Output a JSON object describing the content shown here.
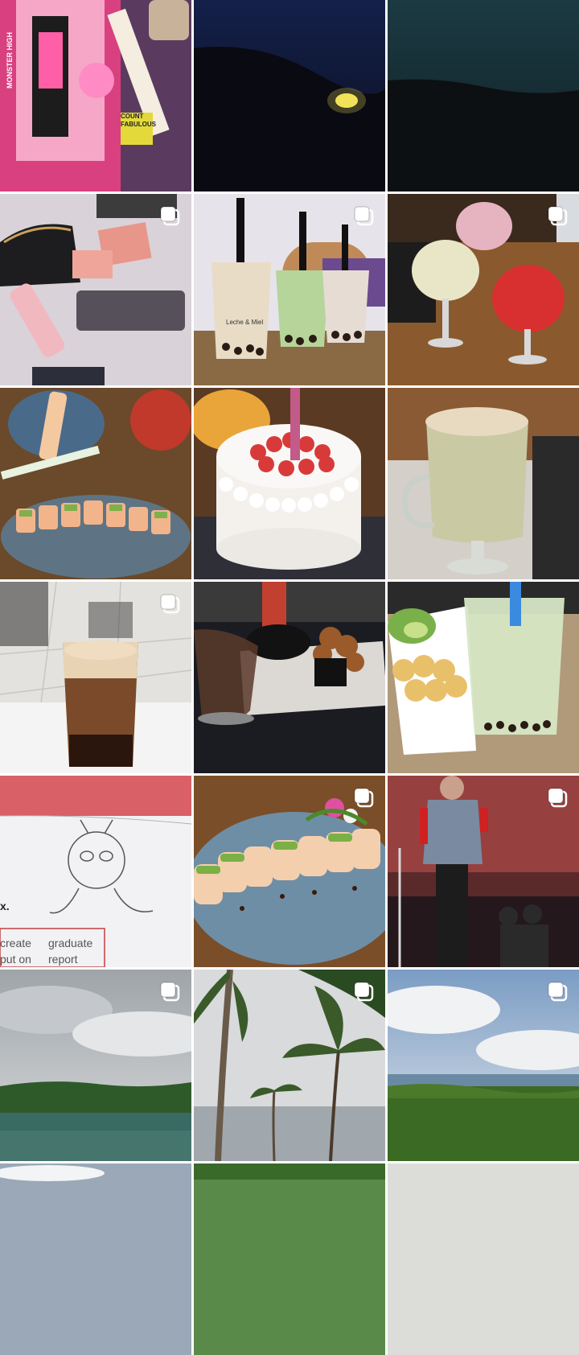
{
  "grid": {
    "tiles": [
      {
        "id": "doll-box",
        "multiple": false
      },
      {
        "id": "night-sky-moon",
        "multiple": false
      },
      {
        "id": "dusk-sky",
        "multiple": false
      },
      {
        "id": "makeup-bag",
        "multiple": true
      },
      {
        "id": "boba-drinks",
        "multiple": true
      },
      {
        "id": "fruit-cocktails",
        "multiple": true
      },
      {
        "id": "sushi-and-drink",
        "multiple": false
      },
      {
        "id": "strawberry-cake",
        "multiple": false
      },
      {
        "id": "matcha-latte",
        "multiple": false
      },
      {
        "id": "iced-coffee",
        "multiple": true
      },
      {
        "id": "fried-food-table",
        "multiple": false
      },
      {
        "id": "bubble-waffle-boba",
        "multiple": false
      },
      {
        "id": "worksheet-drawing",
        "multiple": false
      },
      {
        "id": "sushi-roll-plate",
        "multiple": true
      },
      {
        "id": "concert-singer",
        "multiple": true
      },
      {
        "id": "mangrove-lagoon",
        "multiple": true
      },
      {
        "id": "palm-beach",
        "multiple": true
      },
      {
        "id": "sea-and-jungle",
        "multiple": true
      },
      {
        "id": "next-row-1",
        "multiple": false
      },
      {
        "id": "next-row-2",
        "multiple": false
      },
      {
        "id": "next-row-3",
        "multiple": false
      }
    ]
  },
  "labels": {
    "box_text": "MONSTER HIGH",
    "box_sticker": "COUNT FABULOUS",
    "cup_brand": "Leche & Miel",
    "worksheet_word_1": "create",
    "worksheet_word_2": "graduate",
    "worksheet_word_3": "put on",
    "worksheet_word_4": "report",
    "worksheet_letter": "x."
  },
  "colors": {
    "multi_icon": "#ffffff",
    "background": "#ffffff"
  }
}
